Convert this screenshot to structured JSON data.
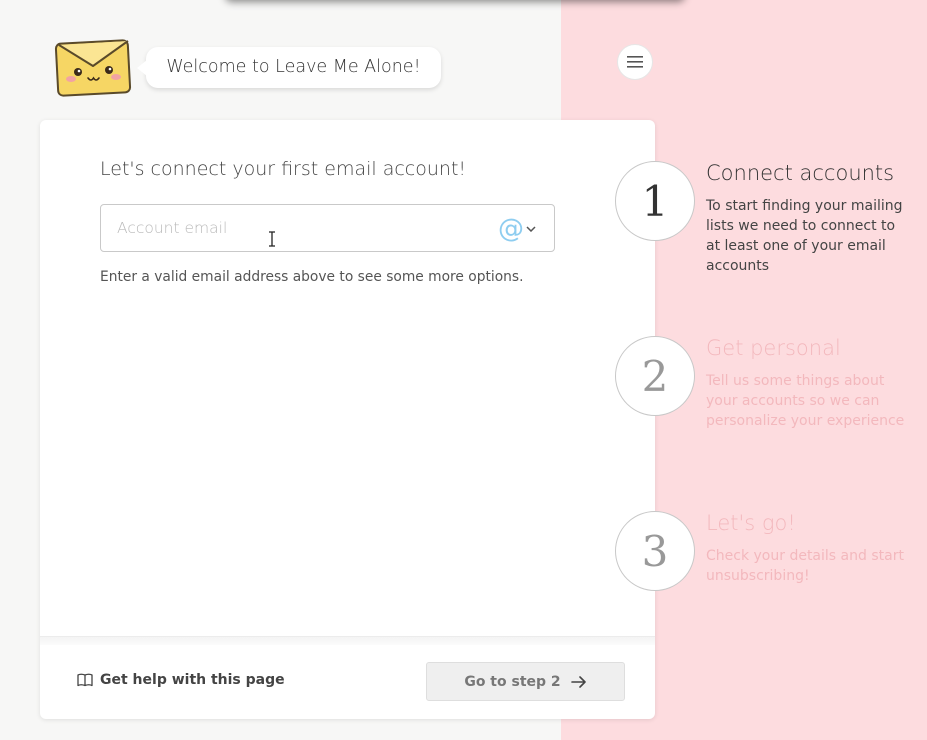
{
  "header": {
    "mascot_icon": "envelope-mascot-icon",
    "welcome_text": "Welcome to Leave Me Alone!",
    "menu_icon": "hamburger-icon"
  },
  "connect_card": {
    "heading": "Let's connect your first email account!",
    "email_input": {
      "value": "",
      "placeholder": "Account email",
      "provider_icon": "at-sign-icon"
    },
    "hint": "Enter a valid email address above to see some more options."
  },
  "footer": {
    "help_icon": "book-icon",
    "help_label": "Get help with this page",
    "next_label": "Go to step 2",
    "next_icon": "arrow-right-icon"
  },
  "steps": [
    {
      "number": "1",
      "title": "Connect accounts",
      "description": "To start finding your mailing lists we need to connect to at least one of your email accounts",
      "state": "active"
    },
    {
      "number": "2",
      "title": "Get personal",
      "description": "Tell us some things about your accounts so we can personalize your experience",
      "state": "inactive"
    },
    {
      "number": "3",
      "title": "Let's go!",
      "description": "Check your details and start unsubscribing!",
      "state": "inactive"
    }
  ],
  "colors": {
    "accent_pink": "#fddcdf",
    "at_icon": "#8ecdf0",
    "mascot": "#f6d664"
  }
}
